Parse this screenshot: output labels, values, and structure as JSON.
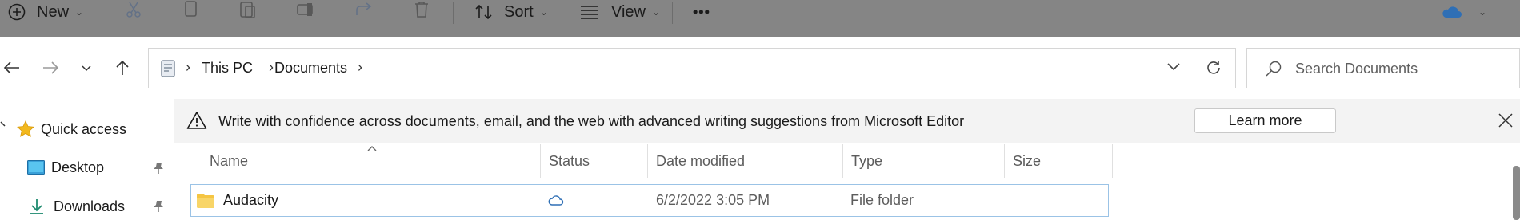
{
  "toolbar": {
    "new_label": "New",
    "sort_label": "Sort",
    "view_label": "View",
    "more_label": "•••"
  },
  "address": {
    "segments": [
      "This PC",
      "Documents"
    ]
  },
  "search": {
    "placeholder": "Search Documents"
  },
  "banner": {
    "message": "Write with confidence across documents, email, and the web with advanced writing suggestions from Microsoft Editor",
    "button_label": "Learn more"
  },
  "columns": [
    {
      "label": "Name"
    },
    {
      "label": "Status"
    },
    {
      "label": "Date modified"
    },
    {
      "label": "Type"
    },
    {
      "label": "Size"
    }
  ],
  "files": [
    {
      "name": "Audacity",
      "date": "6/2/2022 3:05 PM",
      "type": "File folder",
      "size": ""
    }
  ],
  "sidebar": {
    "quick_access": "Quick access",
    "items": [
      {
        "label": "Desktop"
      },
      {
        "label": "Downloads"
      }
    ]
  },
  "colors": {
    "toolbar_bg": "#858585",
    "selection_border": "#9bc3e6",
    "folder": "#f5c542",
    "onedrive": "#2f6fb5"
  }
}
